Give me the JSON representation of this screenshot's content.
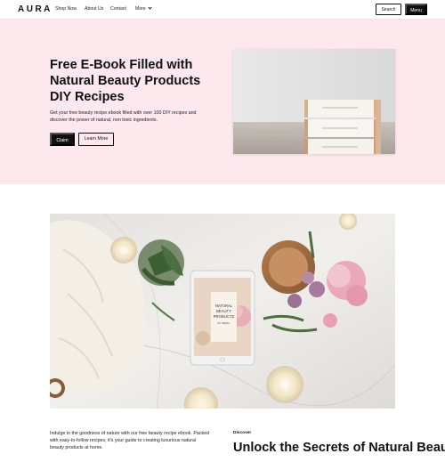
{
  "nav": {
    "logo": "AURA",
    "links": [
      "Shop Now",
      "About Us",
      "Contact",
      "More"
    ],
    "search_label": "Search",
    "menu_label": "Menu"
  },
  "hero": {
    "title": "Free E-Book Filled with Natural Beauty Products DIY Recipes",
    "description": "Get your free beauty recipe ebook filled with over 100 DIY recipes and discover the power of natural, non toxic ingredients.",
    "claim_label": "Claim",
    "learn_label": "Learn More"
  },
  "feature": {
    "tablet_title": "NATURAL BEAUTY PRODUCTS",
    "tablet_byline": "BY MEIRG"
  },
  "intro": {
    "text": "Indulge in the goodness of nature with our free beauty recipe ebook. Packed with easy-to-follow recipes, it's your guide to creating luxurious natural beauty products at home.",
    "eyebrow": "Discover",
    "heading": "Unlock the Secrets of Natural Beauty"
  },
  "colors": {
    "hero_bg": "#fde8ee",
    "primary": "#111111"
  }
}
